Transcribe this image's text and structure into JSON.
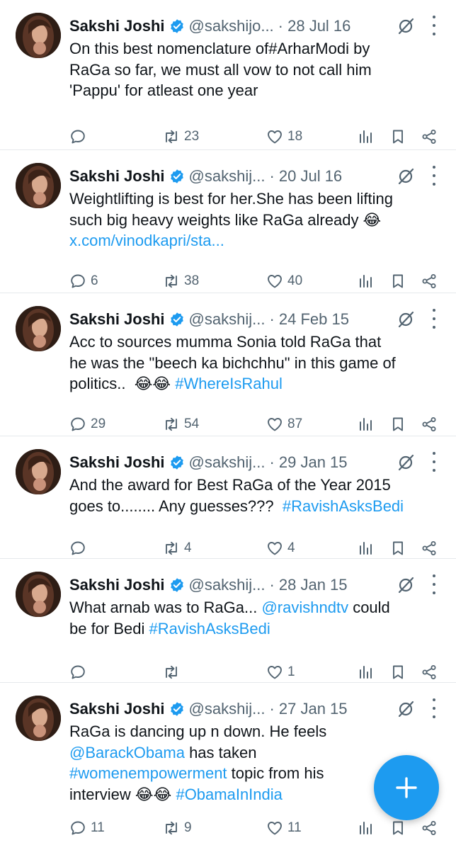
{
  "author": {
    "name": "Sakshi Joshi"
  },
  "colors": {
    "accent": "#1d9bf0",
    "secondary_text": "#536471",
    "divider": "#e6e9ec"
  },
  "tweets": [
    {
      "handle": "@sakshijo...",
      "date": "· 28 Jul 16",
      "lines": [
        [
          {
            "t": "On this best nomenclature of#ArharModi by",
            "link": false
          }
        ],
        [
          {
            "t": "RaGa so far, we must all vow to not call him",
            "link": false
          }
        ],
        [
          {
            "t": "'Pappu' for atleast one year",
            "link": false
          }
        ]
      ],
      "replies": "",
      "reposts": "23",
      "likes": "18"
    },
    {
      "handle": "@sakshij...",
      "date": "· 20 Jul 16",
      "lines": [
        [
          {
            "t": "Weightlifting is best for her.She has been lifting",
            "link": false
          }
        ],
        [
          {
            "t": "such big heavy weights like RaGa already 😂",
            "link": false
          }
        ],
        [
          {
            "t": "x.com/vinodkapri/sta...",
            "link": true
          }
        ]
      ],
      "replies": "6",
      "reposts": "38",
      "likes": "40"
    },
    {
      "handle": "@sakshij...",
      "date": "· 24 Feb 15",
      "lines": [
        [
          {
            "t": "Acc to sources mumma Sonia told RaGa that",
            "link": false
          }
        ],
        [
          {
            "t": "he was the \"beech ka bichchhu\" in this game of",
            "link": false
          }
        ],
        [
          {
            "t": "politics..  😂😂 ",
            "link": false
          },
          {
            "t": "#WhereIsRahul",
            "link": true
          }
        ]
      ],
      "replies": "29",
      "reposts": "54",
      "likes": "87"
    },
    {
      "handle": "@sakshij...",
      "date": "· 29 Jan 15",
      "lines": [
        [
          {
            "t": "And the award for Best RaGa of the Year 2015",
            "link": false
          }
        ],
        [
          {
            "t": "goes to........ Any guesses???  ",
            "link": false
          },
          {
            "t": "#RavishAsksBedi",
            "link": true
          }
        ]
      ],
      "replies": "",
      "reposts": "4",
      "likes": "4"
    },
    {
      "handle": "@sakshij...",
      "date": "· 28 Jan 15",
      "lines": [
        [
          {
            "t": "What arnab was to RaGa... ",
            "link": false
          },
          {
            "t": "@ravishndtv",
            "link": true
          },
          {
            "t": " could",
            "link": false
          }
        ],
        [
          {
            "t": "be for Bedi ",
            "link": false
          },
          {
            "t": "#RavishAsksBedi",
            "link": true
          }
        ]
      ],
      "replies": "",
      "reposts": "",
      "likes": "1"
    },
    {
      "handle": "@sakshij...",
      "date": "· 27 Jan 15",
      "lines": [
        [
          {
            "t": "RaGa is dancing up n down. He feels",
            "link": false
          }
        ],
        [
          {
            "t": "@BarackObama",
            "link": true
          },
          {
            "t": " has taken",
            "link": false
          }
        ],
        [
          {
            "t": "#womenempowerment",
            "link": true
          },
          {
            "t": " topic from his",
            "link": false
          }
        ],
        [
          {
            "t": "interview 😂😂 ",
            "link": false
          },
          {
            "t": "#ObamaInIndia",
            "link": true
          }
        ]
      ],
      "replies": "11",
      "reposts": "9",
      "likes": "11"
    }
  ],
  "icons": {
    "verified": "verified-badge-icon",
    "grok": "grok-icon",
    "more": "more-options-icon",
    "reply": "reply-icon",
    "repost": "repost-icon",
    "like": "heart-icon",
    "views": "views-icon",
    "bookmark": "bookmark-icon",
    "share": "share-icon",
    "compose": "plus-icon"
  }
}
